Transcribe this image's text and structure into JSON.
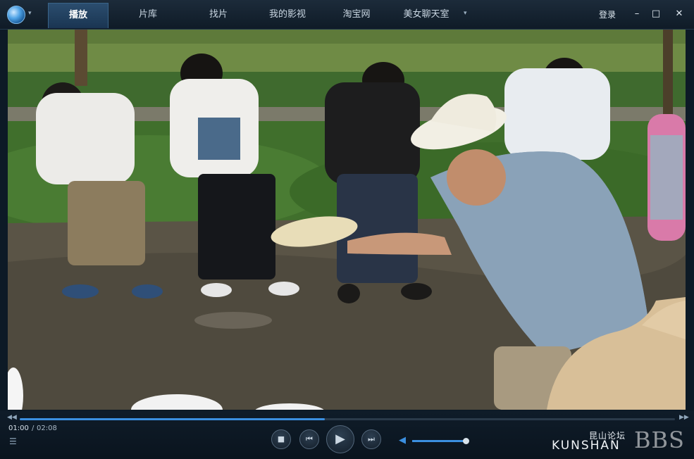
{
  "titlebar": {
    "tabs": [
      {
        "label": "播放",
        "active": true
      },
      {
        "label": "片库",
        "active": false
      },
      {
        "label": "找片",
        "active": false
      },
      {
        "label": "我的影视",
        "active": false
      },
      {
        "label": "淘宝网",
        "active": false
      },
      {
        "label": "美女聊天室",
        "active": false
      }
    ],
    "more_icon": "▾",
    "login_label": "登录",
    "buttons": {
      "minimize": "–",
      "maximize": "□",
      "close": "✕"
    }
  },
  "player": {
    "progress": 0.466,
    "current_time": "01:00",
    "separator": "/",
    "total_time": "02:08",
    "volume": 0.95
  },
  "watermark": {
    "cn": "昆山论坛",
    "en": "KUNSHAN",
    "bbs": "BBS"
  },
  "colors": {
    "accent": "#3b8fe0",
    "titlebar": "#14222f",
    "controls": "#0d1823"
  }
}
